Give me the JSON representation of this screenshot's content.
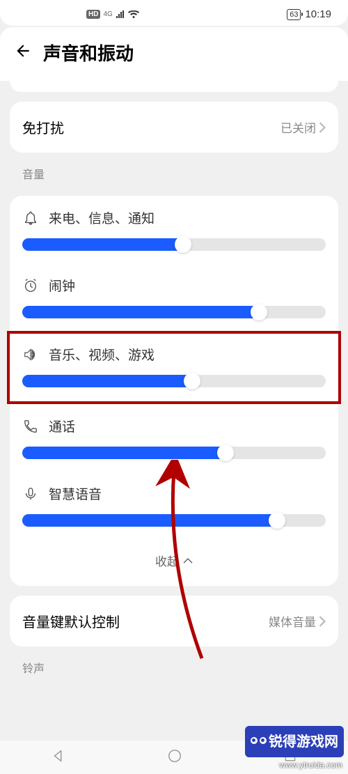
{
  "status": {
    "hd_label": "HD",
    "network_label": "4G",
    "battery_text": "63",
    "time": "10:19"
  },
  "header": {
    "title": "声音和振动"
  },
  "dnd": {
    "label": "免打扰",
    "value": "已关闭"
  },
  "section_volume_label": "音量",
  "volumes": {
    "ring": {
      "label": "来电、信息、通知",
      "percent": 53
    },
    "alarm": {
      "label": "闹钟",
      "percent": 78
    },
    "media": {
      "label": "音乐、视频、游戏",
      "percent": 56
    },
    "call": {
      "label": "通话",
      "percent": 67
    },
    "assistant": {
      "label": "智慧语音",
      "percent": 84
    }
  },
  "collapse_label": "收起",
  "vol_key": {
    "label": "音量键默认控制",
    "value": "媒体音量"
  },
  "section_ringtone_label": "铃声",
  "watermark": {
    "logo_text": "锐得游戏网",
    "url": "www.ytruida.com"
  }
}
